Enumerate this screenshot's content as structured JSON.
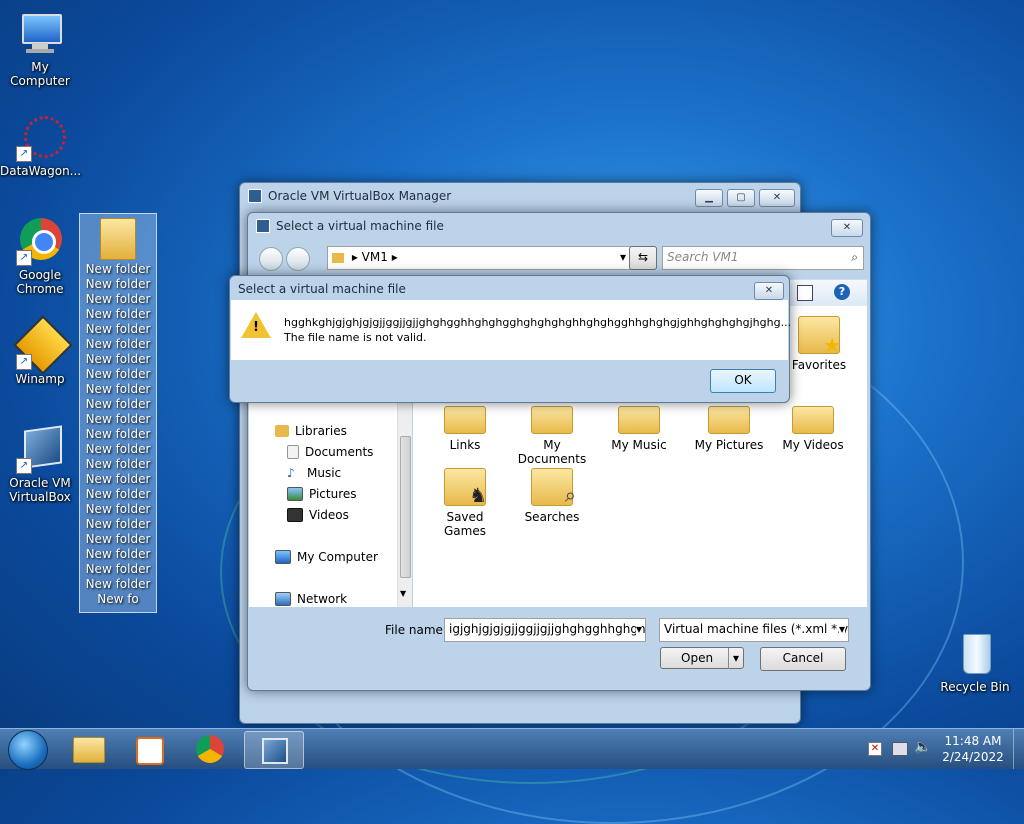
{
  "desktop": {
    "icons": [
      {
        "label": "My Computer"
      },
      {
        "label": "DataWagon..."
      },
      {
        "label": "Google Chrome"
      },
      {
        "label": "Winamp"
      },
      {
        "label": "Oracle VM VirtualBox"
      },
      {
        "label": "Recycle Bin"
      }
    ],
    "folder_name": "New folderNew folderNew folderNew folderNew folderNew folderNew folderNew folderNew folderNew folderNew folderNew folderNew folderNew folderNew folderNew folderNew folderNew folderNew folderNew folderNew folderNew folderNew fo"
  },
  "manager_window": {
    "title": "Oracle VM VirtualBox Manager"
  },
  "file_dialog": {
    "title": "Select a virtual machine file",
    "breadcrumb": "VM1",
    "search_placeholder": "Search VM1",
    "nav": {
      "libraries": "Libraries",
      "documents": "Documents",
      "music": "Music",
      "pictures": "Pictures",
      "videos": "Videos",
      "computer": "My Computer",
      "network": "Network"
    },
    "folders": [
      "Favorites",
      "Links",
      "My Documents",
      "My Music",
      "My Pictures",
      "My Videos",
      "Saved Games",
      "Searches"
    ],
    "file_name_label": "File name:",
    "file_name_value": "igjghjgjgjgjjggjjgjjghghgghhghgh",
    "file_type": "Virtual machine files (*.xml *.vb",
    "open_label": "Open",
    "cancel_label": "Cancel"
  },
  "error_dialog": {
    "title": "Select a virtual machine file",
    "message_line1": "hgghkghjgjghjgjgjjggjjgjjghghgghhghghgghghghghghhghghgghhghghgjghhghghghgjhghg...",
    "message_line2": "The file name is not valid.",
    "ok_label": "OK"
  },
  "taskbar": {
    "time": "11:48 AM",
    "date": "2/24/2022"
  }
}
